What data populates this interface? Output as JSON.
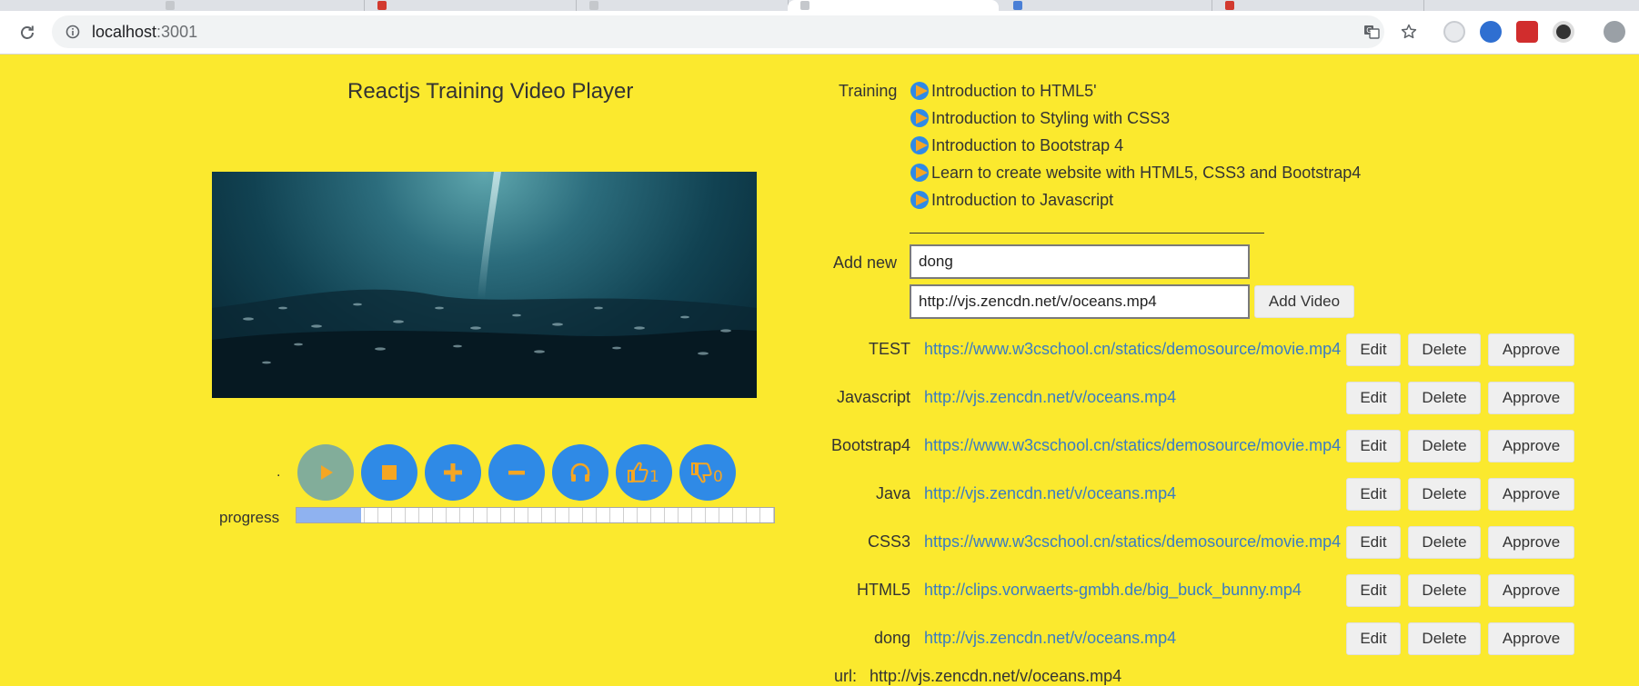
{
  "browser": {
    "url_host": "localhost",
    "url_port": ":3001"
  },
  "player": {
    "title": "Reactjs Training Video Player",
    "dot": ".",
    "progress_label": "progress",
    "progress_value": 0.135,
    "like_count": "1",
    "dislike_count": "0"
  },
  "training": {
    "label": "Training",
    "courses": [
      "Introduction to HTML5'",
      "Introduction to Styling with CSS3",
      "Introduction to Bootstrap 4",
      "Learn to create website with HTML5, CSS3 and Bootstrap4",
      "Introduction to Javascript"
    ]
  },
  "add_new": {
    "label": "Add new",
    "name_value": "dong",
    "url_value": "http://vjs.zencdn.net/v/oceans.mp4",
    "button_label": "Add Video"
  },
  "actions": {
    "edit": "Edit",
    "delete": "Delete",
    "approve": "Approve"
  },
  "videos": [
    {
      "name": "TEST",
      "url": "https://www.w3cschool.cn/statics/demosource/movie.mp4"
    },
    {
      "name": "Javascript",
      "url": "http://vjs.zencdn.net/v/oceans.mp4"
    },
    {
      "name": "Bootstrap4",
      "url": "https://www.w3cschool.cn/statics/demosource/movie.mp4"
    },
    {
      "name": "Java",
      "url": "http://vjs.zencdn.net/v/oceans.mp4"
    },
    {
      "name": "CSS3",
      "url": "https://www.w3cschool.cn/statics/demosource/movie.mp4"
    },
    {
      "name": "HTML5",
      "url": "http://clips.vorwaerts-gmbh.de/big_buck_bunny.mp4"
    },
    {
      "name": "dong",
      "url": "http://vjs.zencdn.net/v/oceans.mp4"
    }
  ],
  "footer": {
    "url_label": "url:",
    "url_value": "http://vjs.zencdn.net/v/oceans.mp4"
  },
  "colors": {
    "page_background": "#fbe92e",
    "control_button": "#2f8ae6",
    "control_icon": "#f5a623",
    "play_button": "#82ad9a",
    "link": "#3a7cc3",
    "progress_fill": "#8fb2f0"
  }
}
